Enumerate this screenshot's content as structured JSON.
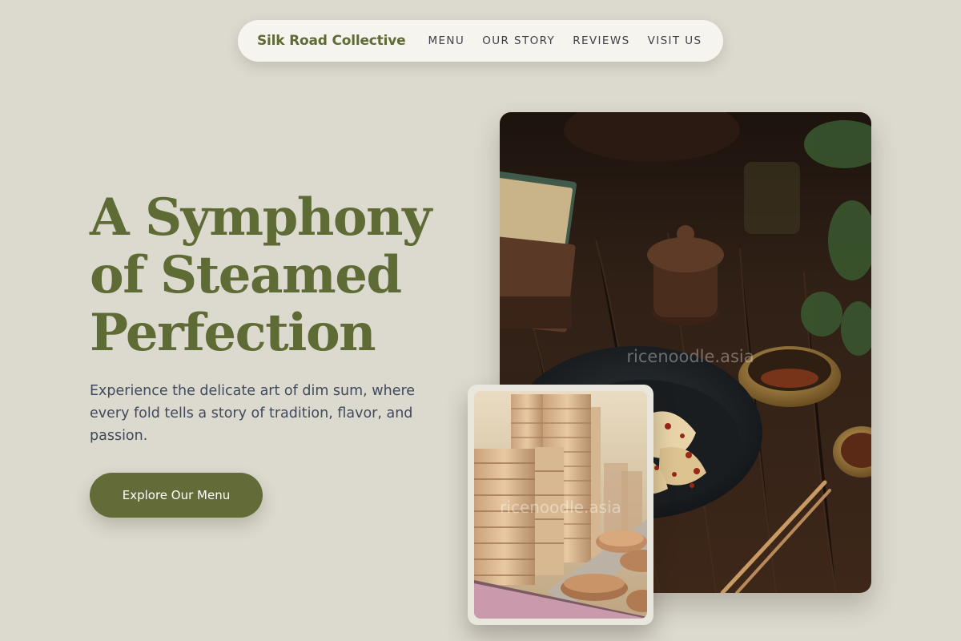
{
  "nav": {
    "brand": "Silk Road Collective",
    "links": [
      "MENU",
      "OUR STORY",
      "REVIEWS",
      "VISIT US"
    ]
  },
  "hero": {
    "title_lines": [
      "A Symphony",
      "of Steamed",
      "Perfection"
    ],
    "description": "Experience the delicate art of dim sum, where every fold tells a story of tradition, flavor, and passion.",
    "cta_label": "Explore Our Menu"
  },
  "images": {
    "main_watermark": "ricenoodle.asia",
    "secondary_watermark": "ricenoodle.asia"
  },
  "colors": {
    "background": "#dcd9cf",
    "brand_olive": "#5e6b35",
    "button": "#636c38",
    "body_text": "#3f4a5c",
    "nav_bg": "#f5f4ef"
  }
}
